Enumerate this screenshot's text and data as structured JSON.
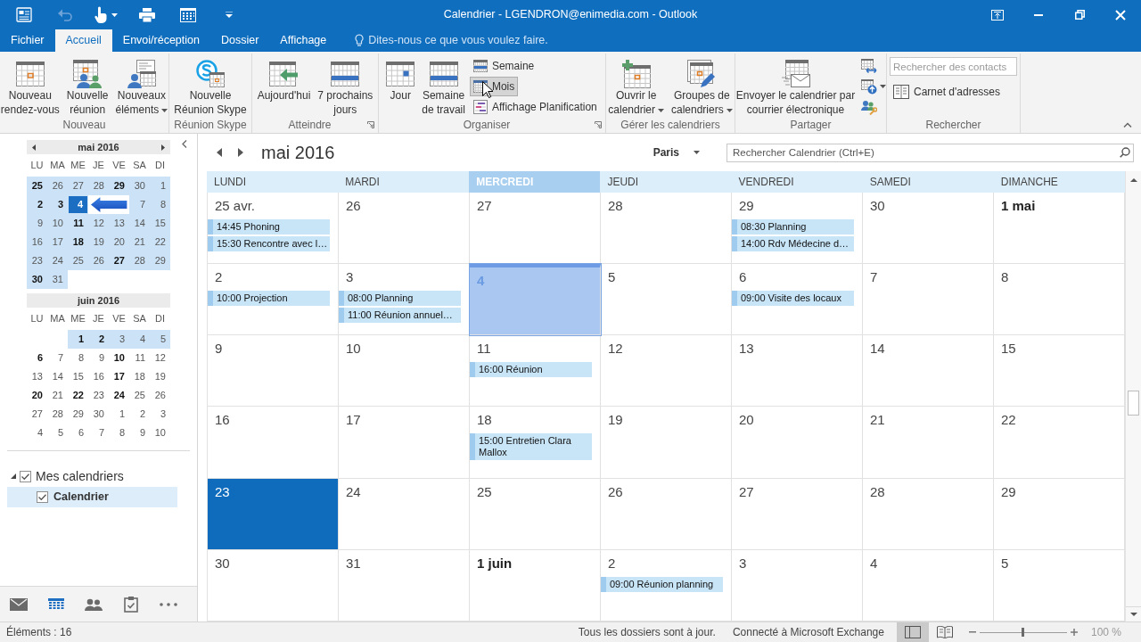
{
  "title_bar": {
    "title": "Calendrier - LGENDRON@enimedia.com - Outlook",
    "quick_access": [
      {
        "disabled": false,
        "dropdown": false
      },
      {
        "disabled": true,
        "dropdown": false
      },
      {
        "disabled": false,
        "dropdown": true
      },
      {
        "disabled": false,
        "dropdown": false
      },
      {
        "disabled": false,
        "dropdown": false
      }
    ]
  },
  "ribbon_tabs": [
    {
      "label": "Fichier",
      "selected": false
    },
    {
      "label": "Accueil",
      "selected": true
    },
    {
      "label": "Envoi/réception",
      "selected": false
    },
    {
      "label": "Dossier",
      "selected": false
    },
    {
      "label": "Affichage",
      "selected": false
    }
  ],
  "tell_me": {
    "placeholder": "Dites-nous ce que vous voulez faire."
  },
  "ribbon_groups": [
    {
      "label": "Nouveau",
      "launcher": false,
      "items": [
        {
          "kind": "large",
          "lines": [
            "Nouveau",
            "rendez-vous"
          ],
          "dropdown": false
        },
        {
          "kind": "large",
          "lines": [
            "Nouvelle",
            "réunion"
          ],
          "dropdown": false
        },
        {
          "kind": "large",
          "lines": [
            "Nouveaux",
            "éléments"
          ],
          "dropdown": true
        }
      ]
    },
    {
      "label": "Réunion Skype",
      "launcher": false,
      "items": [
        {
          "kind": "large",
          "lines": [
            "Nouvelle",
            "Réunion Skype"
          ],
          "dropdown": false
        }
      ]
    },
    {
      "label": "Atteindre",
      "launcher": true,
      "items": [
        {
          "kind": "large",
          "lines": [
            "Aujourd'hui"
          ],
          "dropdown": false
        },
        {
          "kind": "large",
          "lines": [
            "7 prochains",
            "jours"
          ],
          "dropdown": false
        }
      ]
    },
    {
      "label": "Organiser",
      "launcher": true,
      "items": [
        {
          "kind": "large",
          "lines": [
            "Jour"
          ],
          "dropdown": false,
          "selected": false
        },
        {
          "kind": "large",
          "lines": [
            "Semaine",
            "de travail"
          ],
          "dropdown": false,
          "selected": false
        },
        {
          "kind": "small",
          "lines": [
            "Semaine"
          ],
          "dropdown": false,
          "selected": false
        },
        {
          "kind": "small",
          "lines": [
            "Mois"
          ],
          "dropdown": false,
          "selected": true
        },
        {
          "kind": "small",
          "lines": [
            "Affichage Planification"
          ],
          "dropdown": false,
          "selected": false
        }
      ]
    },
    {
      "label": "Gérer les calendriers",
      "launcher": false,
      "items": [
        {
          "kind": "large",
          "lines": [
            "Ouvrir le",
            "calendrier"
          ],
          "dropdown": true
        },
        {
          "kind": "large",
          "lines": [
            "Groupes de",
            "calendriers"
          ],
          "dropdown": true
        }
      ]
    },
    {
      "label": "Partager",
      "launcher": false,
      "items": [
        {
          "kind": "large",
          "lines": [
            "Envoyer le calendrier par",
            "courrier électronique"
          ],
          "dropdown": false
        },
        {
          "kind": "icon",
          "dropdown": false
        },
        {
          "kind": "icon",
          "dropdown": true
        },
        {
          "kind": "icon",
          "dropdown": false
        }
      ]
    },
    {
      "label": "Rechercher",
      "launcher": false,
      "items": [
        {
          "kind": "search",
          "placeholder": "Rechercher des contacts"
        },
        {
          "kind": "small",
          "lines": [
            "Carnet d'adresses"
          ],
          "dropdown": false
        }
      ]
    }
  ],
  "navigation_pane": {
    "mini_calendars": [
      {
        "title": "mai 2016",
        "nav_arrows": true,
        "weekdays": [
          "LU",
          "MA",
          "ME",
          "JE",
          "VE",
          "SA",
          "DI"
        ],
        "weeks": [
          [
            {
              "kind": "day",
              "day": "25",
              "bold": true,
              "in_view": true,
              "selected": false
            },
            {
              "kind": "day",
              "day": "26",
              "bold": false,
              "in_view": true,
              "selected": false
            },
            {
              "kind": "day",
              "day": "27",
              "bold": false,
              "in_view": true,
              "selected": false
            },
            {
              "kind": "day",
              "day": "28",
              "bold": false,
              "in_view": true,
              "selected": false
            },
            {
              "kind": "day",
              "day": "29",
              "bold": true,
              "in_view": true,
              "selected": false
            },
            {
              "kind": "day",
              "day": "30",
              "bold": false,
              "in_view": true,
              "selected": false
            },
            {
              "kind": "day",
              "day": "1",
              "bold": false,
              "in_view": true,
              "selected": false
            }
          ],
          [
            {
              "kind": "day",
              "day": "2",
              "bold": true,
              "in_view": true,
              "selected": false
            },
            {
              "kind": "day",
              "day": "3",
              "bold": true,
              "in_view": true,
              "selected": false
            },
            {
              "kind": "day",
              "day": "4",
              "bold": true,
              "in_view": true,
              "selected": true
            },
            {
              "kind": "blank"
            },
            {
              "kind": "blank"
            },
            {
              "kind": "day",
              "day": "7",
              "bold": false,
              "in_view": true,
              "selected": false
            },
            {
              "kind": "day",
              "day": "8",
              "bold": false,
              "in_view": true,
              "selected": false
            }
          ],
          [
            {
              "kind": "day",
              "day": "9",
              "bold": false,
              "in_view": true,
              "selected": false
            },
            {
              "kind": "day",
              "day": "10",
              "bold": false,
              "in_view": true,
              "selected": false
            },
            {
              "kind": "day",
              "day": "11",
              "bold": true,
              "in_view": true,
              "selected": false
            },
            {
              "kind": "day",
              "day": "12",
              "bold": false,
              "in_view": true,
              "selected": false
            },
            {
              "kind": "day",
              "day": "13",
              "bold": false,
              "in_view": true,
              "selected": false
            },
            {
              "kind": "day",
              "day": "14",
              "bold": false,
              "in_view": true,
              "selected": false
            },
            {
              "kind": "day",
              "day": "15",
              "bold": false,
              "in_view": true,
              "selected": false
            }
          ],
          [
            {
              "kind": "day",
              "day": "16",
              "bold": false,
              "in_view": true,
              "selected": false
            },
            {
              "kind": "day",
              "day": "17",
              "bold": false,
              "in_view": true,
              "selected": false
            },
            {
              "kind": "day",
              "day": "18",
              "bold": true,
              "in_view": true,
              "selected": false
            },
            {
              "kind": "day",
              "day": "19",
              "bold": false,
              "in_view": true,
              "selected": false
            },
            {
              "kind": "day",
              "day": "20",
              "bold": false,
              "in_view": true,
              "selected": false
            },
            {
              "kind": "day",
              "day": "21",
              "bold": false,
              "in_view": true,
              "selected": false
            },
            {
              "kind": "day",
              "day": "22",
              "bold": false,
              "in_view": true,
              "selected": false
            }
          ],
          [
            {
              "kind": "day",
              "day": "23",
              "bold": false,
              "in_view": true,
              "selected": false
            },
            {
              "kind": "day",
              "day": "24",
              "bold": false,
              "in_view": true,
              "selected": false
            },
            {
              "kind": "day",
              "day": "25",
              "bold": false,
              "in_view": true,
              "selected": false
            },
            {
              "kind": "day",
              "day": "26",
              "bold": false,
              "in_view": true,
              "selected": false
            },
            {
              "kind": "day",
              "day": "27",
              "bold": true,
              "in_view": true,
              "selected": false
            },
            {
              "kind": "day",
              "day": "28",
              "bold": false,
              "in_view": true,
              "selected": false
            },
            {
              "kind": "day",
              "day": "29",
              "bold": false,
              "in_view": true,
              "selected": false
            }
          ],
          [
            {
              "kind": "day",
              "day": "30",
              "bold": true,
              "in_view": true,
              "selected": false
            },
            {
              "kind": "day",
              "day": "31",
              "bold": false,
              "in_view": true,
              "selected": false
            }
          ]
        ]
      },
      {
        "title": "juin 2016",
        "nav_arrows": false,
        "weekdays": [
          "LU",
          "MA",
          "ME",
          "JE",
          "VE",
          "SA",
          "DI"
        ],
        "weeks": [
          [
            {
              "kind": "blank"
            },
            {
              "kind": "blank"
            },
            {
              "kind": "day",
              "day": "1",
              "bold": true,
              "in_view": true,
              "selected": false
            },
            {
              "kind": "day",
              "day": "2",
              "bold": true,
              "in_view": true,
              "selected": false
            },
            {
              "kind": "day",
              "day": "3",
              "bold": false,
              "in_view": true,
              "selected": false
            },
            {
              "kind": "day",
              "day": "4",
              "bold": false,
              "in_view": true,
              "selected": false
            },
            {
              "kind": "day",
              "day": "5",
              "bold": false,
              "in_view": true,
              "selected": false
            }
          ],
          [
            {
              "kind": "day",
              "day": "6",
              "bold": true,
              "in_view": false,
              "selected": false
            },
            {
              "kind": "day",
              "day": "7",
              "bold": false,
              "in_view": false,
              "selected": false
            },
            {
              "kind": "day",
              "day": "8",
              "bold": false,
              "in_view": false,
              "selected": false
            },
            {
              "kind": "day",
              "day": "9",
              "bold": false,
              "in_view": false,
              "selected": false
            },
            {
              "kind": "day",
              "day": "10",
              "bold": true,
              "in_view": false,
              "selected": false
            },
            {
              "kind": "day",
              "day": "11",
              "bold": false,
              "in_view": false,
              "selected": false
            },
            {
              "kind": "day",
              "day": "12",
              "bold": false,
              "in_view": false,
              "selected": false
            }
          ],
          [
            {
              "kind": "day",
              "day": "13",
              "bold": false,
              "in_view": false,
              "selected": false
            },
            {
              "kind": "day",
              "day": "14",
              "bold": false,
              "in_view": false,
              "selected": false
            },
            {
              "kind": "day",
              "day": "15",
              "bold": false,
              "in_view": false,
              "selected": false
            },
            {
              "kind": "day",
              "day": "16",
              "bold": false,
              "in_view": false,
              "selected": false
            },
            {
              "kind": "day",
              "day": "17",
              "bold": true,
              "in_view": false,
              "selected": false
            },
            {
              "kind": "day",
              "day": "18",
              "bold": false,
              "in_view": false,
              "selected": false
            },
            {
              "kind": "day",
              "day": "19",
              "bold": false,
              "in_view": false,
              "selected": false
            }
          ],
          [
            {
              "kind": "day",
              "day": "20",
              "bold": true,
              "in_view": false,
              "selected": false
            },
            {
              "kind": "day",
              "day": "21",
              "bold": false,
              "in_view": false,
              "selected": false
            },
            {
              "kind": "day",
              "day": "22",
              "bold": true,
              "in_view": false,
              "selected": false
            },
            {
              "kind": "day",
              "day": "23",
              "bold": false,
              "in_view": false,
              "selected": false
            },
            {
              "kind": "day",
              "day": "24",
              "bold": true,
              "in_view": false,
              "selected": false
            },
            {
              "kind": "day",
              "day": "25",
              "bold": false,
              "in_view": false,
              "selected": false
            },
            {
              "kind": "day",
              "day": "26",
              "bold": false,
              "in_view": false,
              "selected": false
            }
          ],
          [
            {
              "kind": "day",
              "day": "27",
              "bold": false,
              "in_view": false,
              "selected": false
            },
            {
              "kind": "day",
              "day": "28",
              "bold": false,
              "in_view": false,
              "selected": false
            },
            {
              "kind": "day",
              "day": "29",
              "bold": false,
              "in_view": false,
              "selected": false
            },
            {
              "kind": "day",
              "day": "30",
              "bold": false,
              "in_view": false,
              "selected": false
            },
            {
              "kind": "day",
              "day": "1",
              "bold": false,
              "in_view": false,
              "selected": false
            },
            {
              "kind": "day",
              "day": "2",
              "bold": false,
              "in_view": false,
              "selected": false
            },
            {
              "kind": "day",
              "day": "3",
              "bold": false,
              "in_view": false,
              "selected": false
            }
          ],
          [
            {
              "kind": "day",
              "day": "4",
              "bold": false,
              "in_view": false,
              "selected": false
            },
            {
              "kind": "day",
              "day": "5",
              "bold": false,
              "in_view": false,
              "selected": false
            },
            {
              "kind": "day",
              "day": "6",
              "bold": false,
              "in_view": false,
              "selected": false
            },
            {
              "kind": "day",
              "day": "7",
              "bold": false,
              "in_view": false,
              "selected": false
            },
            {
              "kind": "day",
              "day": "8",
              "bold": false,
              "in_view": false,
              "selected": false
            },
            {
              "kind": "day",
              "day": "9",
              "bold": false,
              "in_view": false,
              "selected": false
            },
            {
              "kind": "day",
              "day": "10",
              "bold": false,
              "in_view": false,
              "selected": false
            }
          ]
        ]
      }
    ],
    "folders": [
      {
        "label": "Mes calendriers",
        "expanded": true,
        "checked": true,
        "selected": false,
        "children": [
          {
            "label": "Calendrier",
            "checked": true,
            "selected": true
          }
        ]
      }
    ],
    "nav_bar": [
      {
        "selected": false
      },
      {
        "selected": true
      },
      {
        "selected": false
      },
      {
        "selected": false
      },
      {
        "selected": false
      }
    ]
  },
  "calendar": {
    "title": "mai 2016",
    "time_zone": "Paris",
    "search": {
      "placeholder": "Rechercher Calendrier (Ctrl+E)"
    },
    "weekdays": [
      {
        "label": "LUNDI",
        "today": false
      },
      {
        "label": "MARDI",
        "today": false
      },
      {
        "label": "MERCREDI",
        "today": true
      },
      {
        "label": "JEUDI",
        "today": false
      },
      {
        "label": "VENDREDI",
        "today": false
      },
      {
        "label": "SAMEDI",
        "today": false
      },
      {
        "label": "DIMANCHE",
        "today": false
      }
    ],
    "weeks": [
      [
        {
          "label": "25 avr.",
          "bold": false,
          "today": false,
          "selected": false,
          "events": [
            "14:45 Phoning",
            "15:30 Rencontre avec l…"
          ]
        },
        {
          "label": "26",
          "bold": false,
          "today": false,
          "selected": false
        },
        {
          "label": "27",
          "bold": false,
          "today": false,
          "selected": false
        },
        {
          "label": "28",
          "bold": false,
          "today": false,
          "selected": false
        },
        {
          "label": "29",
          "bold": false,
          "today": false,
          "selected": false,
          "events": [
            "08:30 Planning",
            "14:00 Rdv Médecine d…"
          ]
        },
        {
          "label": "30",
          "bold": false,
          "today": false,
          "selected": false
        },
        {
          "label": "1 mai",
          "bold": true,
          "today": false,
          "selected": false
        }
      ],
      [
        {
          "label": "2",
          "bold": false,
          "today": false,
          "selected": false,
          "events": [
            "10:00 Projection"
          ]
        },
        {
          "label": "3",
          "bold": false,
          "today": false,
          "selected": false,
          "events": [
            "08:00 Planning",
            "11:00 Réunion annuel…"
          ]
        },
        {
          "label": "4",
          "bold": true,
          "today": true,
          "selected": false
        },
        {
          "label": "5",
          "bold": false,
          "today": false,
          "selected": false
        },
        {
          "label": "6",
          "bold": false,
          "today": false,
          "selected": false,
          "events": [
            "09:00 Visite des locaux"
          ]
        },
        {
          "label": "7",
          "bold": false,
          "today": false,
          "selected": false
        },
        {
          "label": "8",
          "bold": false,
          "today": false,
          "selected": false
        }
      ],
      [
        {
          "label": "9",
          "bold": false,
          "today": false,
          "selected": false
        },
        {
          "label": "10",
          "bold": false,
          "today": false,
          "selected": false
        },
        {
          "label": "11",
          "bold": false,
          "today": false,
          "selected": false,
          "events": [
            "16:00 Réunion"
          ]
        },
        {
          "label": "12",
          "bold": false,
          "today": false,
          "selected": false
        },
        {
          "label": "13",
          "bold": false,
          "today": false,
          "selected": false
        },
        {
          "label": "14",
          "bold": false,
          "today": false,
          "selected": false
        },
        {
          "label": "15",
          "bold": false,
          "today": false,
          "selected": false
        }
      ],
      [
        {
          "label": "16",
          "bold": false,
          "today": false,
          "selected": false
        },
        {
          "label": "17",
          "bold": false,
          "today": false,
          "selected": false
        },
        {
          "label": "18",
          "bold": false,
          "today": false,
          "selected": false,
          "events": [
            "15:00 Entretien Clara Mallox"
          ]
        },
        {
          "label": "19",
          "bold": false,
          "today": false,
          "selected": false
        },
        {
          "label": "20",
          "bold": false,
          "today": false,
          "selected": false
        },
        {
          "label": "21",
          "bold": false,
          "today": false,
          "selected": false
        },
        {
          "label": "22",
          "bold": false,
          "today": false,
          "selected": false
        }
      ],
      [
        {
          "label": "23",
          "bold": false,
          "today": false,
          "selected": true
        },
        {
          "label": "24",
          "bold": false,
          "today": false,
          "selected": false
        },
        {
          "label": "25",
          "bold": false,
          "today": false,
          "selected": false
        },
        {
          "label": "26",
          "bold": false,
          "today": false,
          "selected": false
        },
        {
          "label": "27",
          "bold": false,
          "today": false,
          "selected": false
        },
        {
          "label": "28",
          "bold": false,
          "today": false,
          "selected": false
        },
        {
          "label": "29",
          "bold": false,
          "today": false,
          "selected": false
        }
      ],
      [
        {
          "label": "30",
          "bold": false,
          "today": false,
          "selected": false
        },
        {
          "label": "31",
          "bold": false,
          "today": false,
          "selected": false
        },
        {
          "label": "1 juin",
          "bold": true,
          "today": false,
          "selected": false
        },
        {
          "label": "2",
          "bold": false,
          "today": false,
          "selected": false,
          "events": [
            "09:00 Réunion planning"
          ]
        },
        {
          "label": "3",
          "bold": false,
          "today": false,
          "selected": false
        },
        {
          "label": "4",
          "bold": false,
          "today": false,
          "selected": false
        },
        {
          "label": "5",
          "bold": false,
          "today": false,
          "selected": false
        }
      ]
    ]
  },
  "status_bar": {
    "items": "Éléments : 16",
    "sync": "Tous les dossiers sont à jour.",
    "connection": "Connecté à Microsoft Exchange",
    "views": [
      {
        "selected": true
      },
      {
        "selected": false
      }
    ],
    "zoom": {
      "level": 0.5,
      "reading": "100 %"
    }
  }
}
